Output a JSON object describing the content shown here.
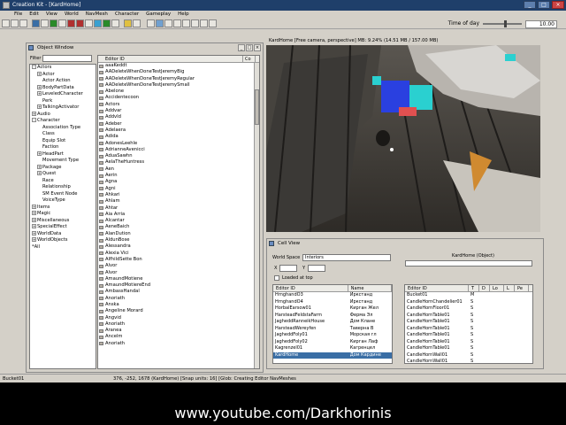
{
  "window": {
    "title": "Creation Kit - [KardHome]"
  },
  "menu": [
    "File",
    "Edit",
    "View",
    "World",
    "NavMesh",
    "Character",
    "Gameplay",
    "Help"
  ],
  "toolbar": {
    "time_of_day_label": "Time of day",
    "time_of_day_value": "10.00"
  },
  "object_window": {
    "title": "Object Window",
    "filter_label": "Filter",
    "tree": [
      {
        "label": "Actors",
        "indent": 0,
        "exp": "-"
      },
      {
        "label": "Actor",
        "indent": 1,
        "exp": "+"
      },
      {
        "label": "Actor Action",
        "indent": 2,
        "exp": ""
      },
      {
        "label": "BodyPartData",
        "indent": 1,
        "exp": "+"
      },
      {
        "label": "LeveledCharacter",
        "indent": 1,
        "exp": "+"
      },
      {
        "label": "Perk",
        "indent": 2,
        "exp": ""
      },
      {
        "label": "TalkingActivator",
        "indent": 1,
        "exp": "+"
      },
      {
        "label": "Audio",
        "indent": 0,
        "exp": "+"
      },
      {
        "label": "Character",
        "indent": 0,
        "exp": "-"
      },
      {
        "label": "Association Type",
        "indent": 2,
        "exp": ""
      },
      {
        "label": "Class",
        "indent": 2,
        "exp": ""
      },
      {
        "label": "Equip Slot",
        "indent": 2,
        "exp": ""
      },
      {
        "label": "Faction",
        "indent": 2,
        "exp": ""
      },
      {
        "label": "HeadPart",
        "indent": 1,
        "exp": "+"
      },
      {
        "label": "Movement Type",
        "indent": 2,
        "exp": ""
      },
      {
        "label": "Package",
        "indent": 1,
        "exp": "+"
      },
      {
        "label": "Quest",
        "indent": 1,
        "exp": "+"
      },
      {
        "label": "Race",
        "indent": 2,
        "exp": ""
      },
      {
        "label": "Relationship",
        "indent": 2,
        "exp": ""
      },
      {
        "label": "SM Event Node",
        "indent": 2,
        "exp": ""
      },
      {
        "label": "VoiceType",
        "indent": 2,
        "exp": ""
      },
      {
        "label": "Items",
        "indent": 0,
        "exp": "+"
      },
      {
        "label": "Magic",
        "indent": 0,
        "exp": "+"
      },
      {
        "label": "Miscellaneous",
        "indent": 0,
        "exp": "+"
      },
      {
        "label": "SpecialEffect",
        "indent": 0,
        "exp": "+"
      },
      {
        "label": "WorldData",
        "indent": 0,
        "exp": "+"
      },
      {
        "label": "WorldObjects",
        "indent": 0,
        "exp": "+"
      },
      {
        "label": "*All",
        "indent": 0,
        "exp": ""
      }
    ],
    "list_headers": [
      "Editor ID",
      "Co"
    ],
    "list": [
      "aaaKeddt",
      "AADeleteWhenDoneTestJeremyBig",
      "AADeleteWhenDoneTestJeremyRegular",
      "AADeleteWhenDoneTestJeremySmall",
      "Abelone",
      "Accidentecoon",
      "Actors",
      "Addvar",
      "AddvId",
      "Adeber",
      "Adelaera",
      "Adida",
      "AdonesLeehle",
      "AdrianneAvenicci",
      "AduaSawhn",
      "AelaTheHuntress",
      "Aen",
      "Aerin",
      "Agna",
      "Agni",
      "Ahkari",
      "Ahlam",
      "Ahtar",
      "Aia Arria",
      "Alcantar",
      "AeneBaich",
      "AlanDution",
      "AldunBose",
      "Alessandra",
      "Alexia Vici",
      "AlfhildSette Bon",
      "Alvor",
      "Alvor",
      "AmaundMotiene",
      "AmaundMotiereEnd",
      "AmbassHandal",
      "Anoriath",
      "Anska",
      "Angeline Morard",
      "Angvid",
      "Anoriath",
      "Aranea",
      "Ancelm",
      "Anoriath"
    ]
  },
  "render": {
    "title": "KardHome [Free camera, perspective]    MB: 9.24% (14.51 MB / 157.00 MB)"
  },
  "cell_view": {
    "title": "Cell View",
    "worldspace_label": "World Space",
    "worldspace_value": "Interiors",
    "x_label": "X",
    "y_label": "Y",
    "loaded_label": "Loaded at top",
    "right_label": "KardHome (Object)",
    "left_headers": [
      "Editor ID",
      "Name"
    ],
    "left_rows": [
      {
        "id": "HrnghandO3",
        "name": "Иркстанд"
      },
      {
        "id": "HrnghandO4",
        "name": "Иркстанд"
      },
      {
        "id": "HorbalEarsow01",
        "name": "Кирган Жел"
      },
      {
        "id": "HarsteadFeldstaFarm",
        "name": "Ферма Эл"
      },
      {
        "id": "JagheddRanneikHouse",
        "name": "Дом Клане"
      },
      {
        "id": "HarsteadWereyfen",
        "name": "Таверна В"
      },
      {
        "id": "JagheddFoly01",
        "name": "Морская гл"
      },
      {
        "id": "JagheddFoly02",
        "name": "Кирган Лаф"
      },
      {
        "id": "Kagrenzel01",
        "name": "Кагренцел"
      },
      {
        "id": "KardHome",
        "name": "Дом Кардине",
        "sel": true
      }
    ],
    "right_headers": [
      "Editor ID",
      "T",
      "D",
      "Lo",
      "L",
      "Pe"
    ],
    "right_rows": [
      {
        "id": "Bucket01",
        "t": "M"
      },
      {
        "id": "CandleHornChandelier01",
        "t": "S"
      },
      {
        "id": "CandleHornFloor01",
        "t": "S"
      },
      {
        "id": "CandleHornTable01",
        "t": "S"
      },
      {
        "id": "CandleHornTable01",
        "t": "S"
      },
      {
        "id": "CandleHornTable01",
        "t": "S"
      },
      {
        "id": "CandleHornTable01",
        "t": "S"
      },
      {
        "id": "CandleHornTable01",
        "t": "S"
      },
      {
        "id": "CandleHornTable01",
        "t": "S"
      },
      {
        "id": "CandleHornWall01",
        "t": "S"
      },
      {
        "id": "CandleHornWall01",
        "t": "S"
      },
      {
        "id": "CandleHornWall01",
        "t": "S"
      }
    ]
  },
  "status": {
    "left": "Bucket01",
    "right": "376, -252, 1678 (KardHome) [Snap units: 16] [Glob: Creating Editor NavMeshes"
  },
  "watermark": "www.youtube.com/Darkhorinis"
}
